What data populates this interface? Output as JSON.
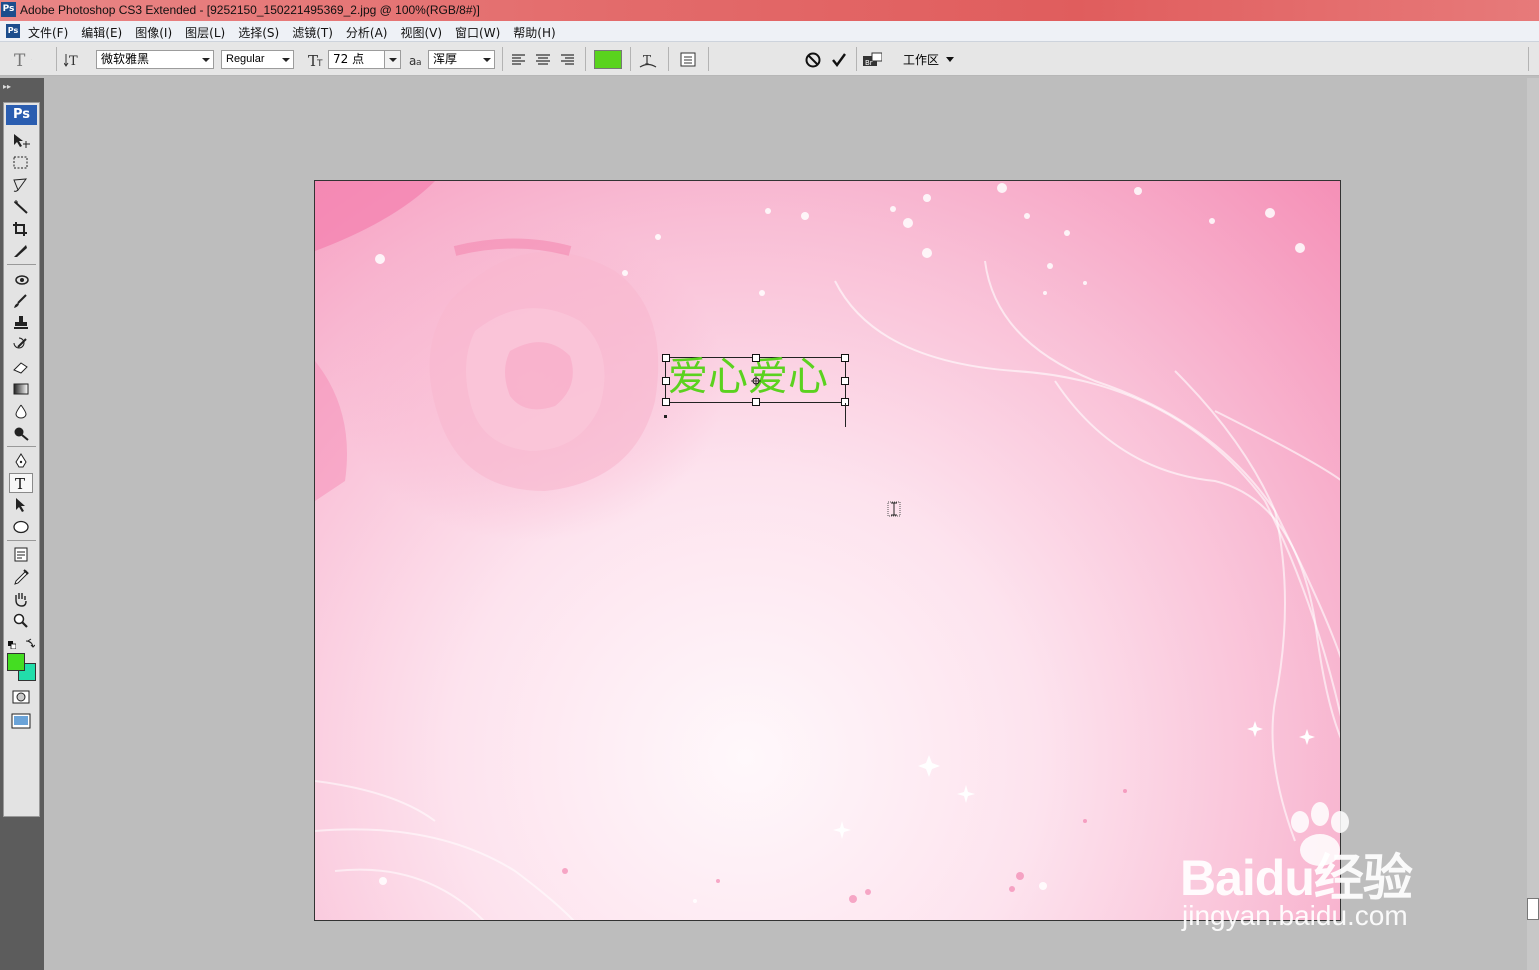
{
  "window": {
    "title": "Adobe Photoshop CS3 Extended - [9252150_150221495369_2.jpg @ 100%(RGB/8#)]"
  },
  "menu": [
    "文件(F)",
    "编辑(E)",
    "图像(I)",
    "图层(L)",
    "选择(S)",
    "滤镜(T)",
    "分析(A)",
    "视图(V)",
    "窗口(W)",
    "帮助(H)"
  ],
  "options": {
    "font_family": "微软雅黑",
    "font_style": "Regular",
    "font_size": "72 点",
    "antialias": "浑厚",
    "text_color": "#5ad31e",
    "workspace_label": "工作区"
  },
  "toolbox": {
    "logo": "Ps",
    "foreground_color": "#44dd22",
    "background_color": "#22ddaa"
  },
  "canvas": {
    "text_layer": "爱心爱心",
    "text_color": "#5bd21f"
  },
  "watermark": {
    "brand": "Baidu经验",
    "url": "jingyan.baidu.com"
  }
}
